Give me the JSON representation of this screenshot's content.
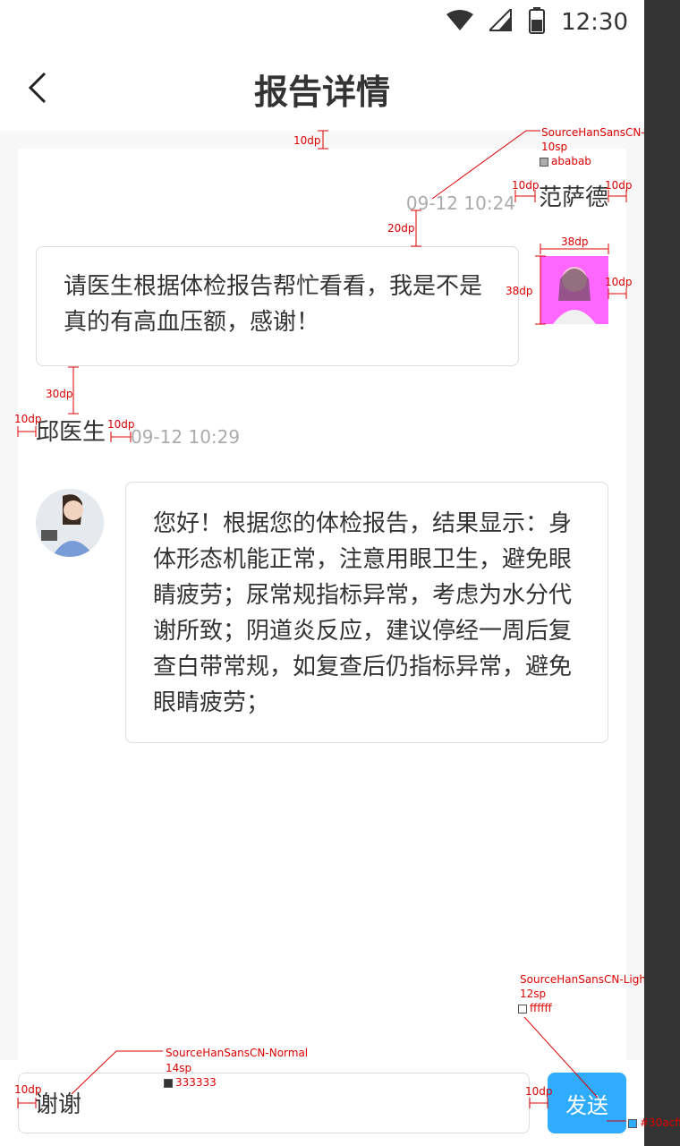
{
  "status_bar": {
    "time": "12:30"
  },
  "header": {
    "title": "报告详情"
  },
  "user_message": {
    "name": "范萨德",
    "time": "09-12 10:24",
    "text": "请医生根据体检报告帮忙看看，我是不是真的有高血压额，感谢！"
  },
  "doctor_message": {
    "name": "邱医生",
    "time": "09-12 10:29",
    "text": "您好！根据您的体检报告，结果显示：身体形态机能正常，注意用眼卫生，避免眼睛疲劳；尿常规指标异常，考虑为水分代谢所致；阴道炎反应，建议停经一周后复查白带常规，如复查后仍指标异常，避免眼睛疲劳；"
  },
  "input": {
    "value": "谢谢"
  },
  "send_button": {
    "label": "发送"
  },
  "annotations": {
    "time_font": "SourceHanSansCN-Light",
    "time_size": "10sp",
    "time_color": "ababab",
    "send_font": "SourceHanSansCN-Light",
    "send_size": "12sp",
    "send_color": "ffffff",
    "input_font": "SourceHanSansCN-Normal",
    "input_size": "14sp",
    "input_color": "333333",
    "send_bg": "#30acff",
    "d10": "10dp",
    "d20": "20dp",
    "d30": "30dp",
    "d38": "38dp"
  },
  "colors": {
    "accent": "#30acff",
    "time_gray": "#ababab",
    "text": "#333333"
  }
}
